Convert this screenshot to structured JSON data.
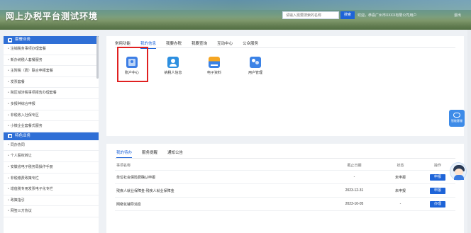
{
  "header": {
    "title": "网上办税平台测试环境",
    "search_placeholder": "请输入需要搜索的名称",
    "search_button": "搜索",
    "user_info": "欢迎，恭喜广州市XXXX有限公司用户",
    "logout": "退出"
  },
  "sidebar": {
    "section1": "套餐业务",
    "items1": [
      "注销税务事项办理套餐",
      "新办纳税人套餐服务",
      "主附税（费）联合申报套餐",
      "发票套餐",
      "跨区域涉税事项报告办理套餐",
      "多报种综合申报",
      "非税收入社保专区",
      "小微企业套餐式服务"
    ],
    "section2": "特色业务",
    "items2": [
      "同办协同",
      "个人股权转让",
      "安徽省电子税务局操作手册",
      "非税缴费政策专栏",
      "增值税专用发票电子化专栏",
      "政策指引",
      "网签三方协议"
    ]
  },
  "top_tabs": [
    "常用功能",
    "我的信息",
    "我要办税",
    "我要查询",
    "互动中心",
    "公众服务"
  ],
  "apps": [
    {
      "label": "账户中心",
      "icon": "account-center-icon"
    },
    {
      "label": "纳税人信息",
      "icon": "taxpayer-info-icon"
    },
    {
      "label": "电子资料",
      "icon": "electronic-docs-icon"
    },
    {
      "label": "用户管理",
      "icon": "user-management-icon"
    }
  ],
  "bottom_tabs": [
    "我的待办",
    "服务提醒",
    "通知公告"
  ],
  "table": {
    "headers": [
      "事项名称",
      "截止日期",
      "状态",
      "操作"
    ],
    "rows": [
      {
        "name": "单位社会保险费确认申报",
        "deadline": "-",
        "status": "未申报",
        "action": "申报"
      },
      {
        "name": "残疾人就业保障金-残疾人就业保障金",
        "deadline": "2023-12-31",
        "status": "未申报",
        "action": "申报"
      },
      {
        "name": "网络化辅导消息",
        "deadline": "2023-10-05",
        "status": "-",
        "action": "办理"
      }
    ]
  },
  "float": {
    "chat_label": "智能客服"
  },
  "colors": {
    "accent": "#1e64d8",
    "sidebar_header": "#2f6fd6",
    "highlight": "#e02020"
  }
}
